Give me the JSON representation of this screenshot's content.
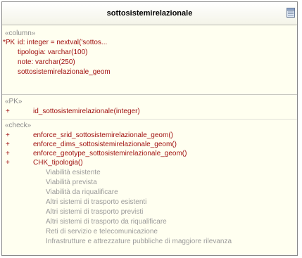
{
  "table": {
    "name": "sottosistemirelazionale",
    "icon": "table-icon"
  },
  "columns": {
    "stereotype": "«column»",
    "pk_marker": "*PK",
    "items": [
      "id:  integer = nextval('sottos...",
      "tipologia:  varchar(100)",
      "note:  varchar(250)",
      "sottosistemirelazionale_geom"
    ]
  },
  "pk": {
    "stereotype": "«PK»",
    "marker": "+",
    "items": [
      "id_sottosistemirelazionale(integer)"
    ]
  },
  "check": {
    "stereotype": "«check»",
    "marker": "+",
    "items": [
      "enforce_srid_sottosistemirelazionale_geom()",
      "enforce_dims_sottosistemirelazionale_geom()",
      "enforce_geotype_sottosistemirelazionale_geom()",
      "CHK_tipologia()"
    ],
    "values": [
      "Viabilità esistente",
      "Viabilità prevista",
      "Viabilità da riqualificare",
      "Altri sistemi di trasporto esistenti",
      "Altri sistemi di trasporto previsti",
      "Altri sistemi di trasporto da riqualificare",
      "Reti di servizio e telecomunicazione",
      "Infrastrutture e attrezzature pubbliche di maggiore rilevanza"
    ]
  }
}
